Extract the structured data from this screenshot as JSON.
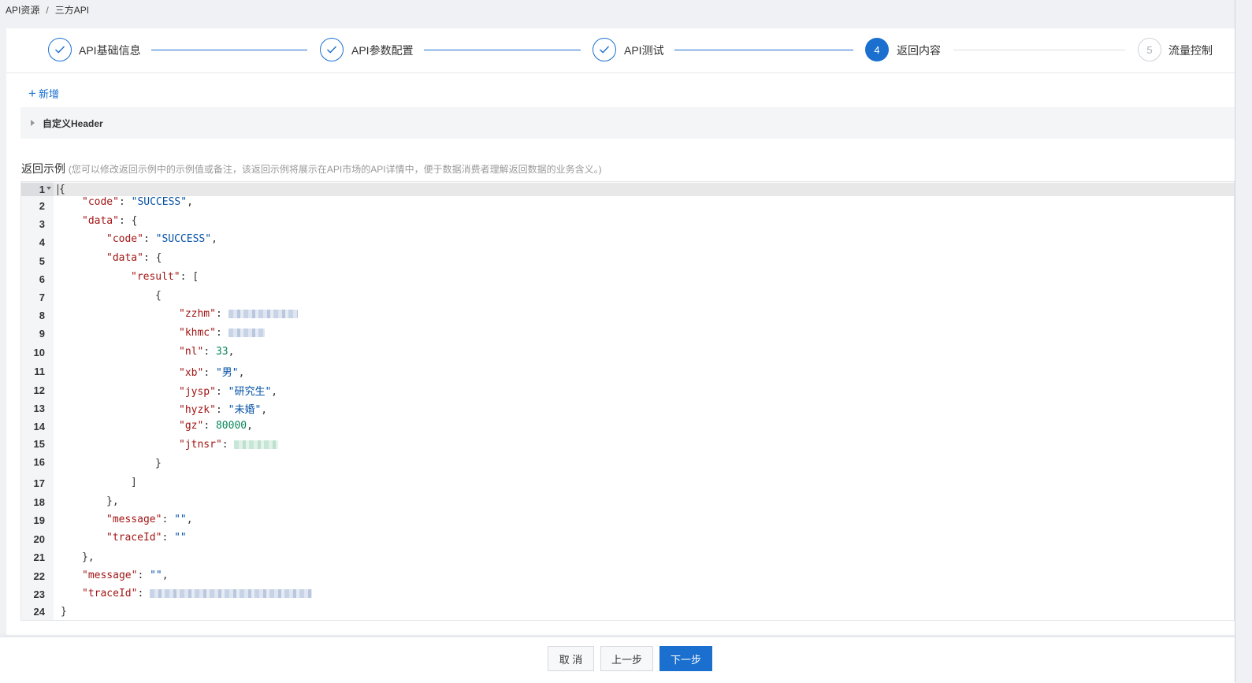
{
  "breadcrumb": {
    "items": [
      "API资源",
      "三方API"
    ],
    "separator": "/"
  },
  "steps": [
    {
      "label": "API基础信息",
      "state": "done",
      "icon": "check-icon"
    },
    {
      "label": "API参数配置",
      "state": "done",
      "icon": "check-icon"
    },
    {
      "label": "API测试",
      "state": "done",
      "icon": "check-icon"
    },
    {
      "label": "返回内容",
      "state": "active",
      "number": "4"
    },
    {
      "label": "流量控制",
      "state": "todo",
      "number": "5"
    }
  ],
  "add_button": {
    "label": "新增",
    "icon": "plus-icon"
  },
  "custom_header": {
    "title": "自定义Header"
  },
  "return_example": {
    "title": "返回示例",
    "hint": "(您可以修改返回示例中的示例值或备注，该返回示例将展示在API市场的API详情中，便于数据消费者理解返回数据的业务含义。)"
  },
  "editor": {
    "line_numbers": [
      "1",
      "2",
      "3",
      "4",
      "5",
      "6",
      "7",
      "8",
      "9",
      "10",
      "11",
      "12",
      "13",
      "14",
      "15",
      "16",
      "17",
      "18",
      "19",
      "20",
      "21",
      "22",
      "23",
      "24"
    ],
    "keys": {
      "code": "\"code\"",
      "data": "\"data\"",
      "result": "\"result\"",
      "zzhm": "\"zzhm\"",
      "khmc": "\"khmc\"",
      "nl": "\"nl\"",
      "xb": "\"xb\"",
      "jysp": "\"jysp\"",
      "hyzk": "\"hyzk\"",
      "gz": "\"gz\"",
      "jtnsr": "\"jtnsr\"",
      "message": "\"message\"",
      "traceId": "\"traceId\""
    },
    "values": {
      "success": "\"SUCCESS\"",
      "nl": "33",
      "xb": "\"男\"",
      "jysp": "\"研究生\"",
      "hyzk": "\"未婚\"",
      "gz": "80000",
      "empty": "\"\""
    }
  },
  "footer": {
    "cancel": "取 消",
    "prev": "上一步",
    "next": "下一步"
  },
  "colors": {
    "primary": "#1a6fcf",
    "key": "#a31515",
    "string": "#0451a5",
    "number": "#098658"
  }
}
